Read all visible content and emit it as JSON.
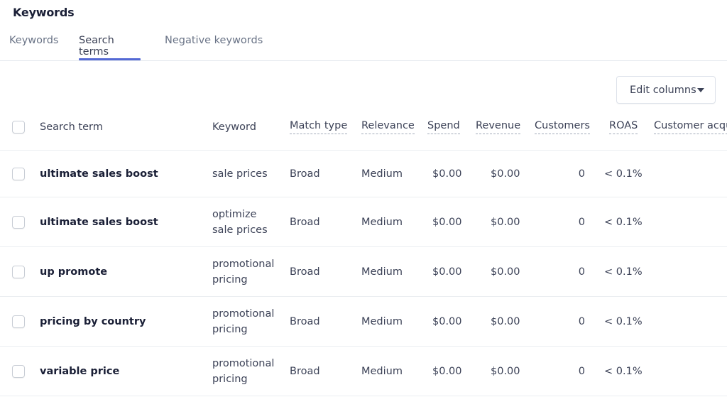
{
  "page": {
    "title": "Keywords"
  },
  "tabs": [
    {
      "label": "Keywords",
      "active": false
    },
    {
      "label": "Search terms",
      "active": true
    },
    {
      "label": "Negative keywords",
      "active": false
    }
  ],
  "toolbar": {
    "edit_columns_label": "Edit columns",
    "edit_columns_icon": "caret-down-icon"
  },
  "colors": {
    "accent": "#5469d4",
    "text_primary": "#1a1f36",
    "text_secondary": "#697386",
    "border": "#e3e8ee"
  },
  "table": {
    "columns": [
      {
        "key": "search_term",
        "label": "Search term"
      },
      {
        "key": "keyword",
        "label": "Keyword"
      },
      {
        "key": "match_type",
        "label": "Match type"
      },
      {
        "key": "relevance",
        "label": "Relevance"
      },
      {
        "key": "spend",
        "label": "Spend"
      },
      {
        "key": "revenue",
        "label": "Revenue"
      },
      {
        "key": "customers",
        "label": "Customers"
      },
      {
        "key": "roas",
        "label": "ROAS"
      },
      {
        "key": "customer_acquisition",
        "label": "Customer acqui"
      }
    ],
    "rows": [
      {
        "search_term": "ultimate sales boost",
        "keyword": "sale prices",
        "match_type": "Broad",
        "relevance": "Medium",
        "spend": "$0.00",
        "revenue": "$0.00",
        "customers": "0",
        "roas": "< 0.1%"
      },
      {
        "search_term": "ultimate sales boost",
        "keyword": "optimize sale prices",
        "match_type": "Broad",
        "relevance": "Medium",
        "spend": "$0.00",
        "revenue": "$0.00",
        "customers": "0",
        "roas": "< 0.1%"
      },
      {
        "search_term": "up promote",
        "keyword": "promotional pricing",
        "match_type": "Broad",
        "relevance": "Medium",
        "spend": "$0.00",
        "revenue": "$0.00",
        "customers": "0",
        "roas": "< 0.1%"
      },
      {
        "search_term": "pricing by country",
        "keyword": "promotional pricing",
        "match_type": "Broad",
        "relevance": "Medium",
        "spend": "$0.00",
        "revenue": "$0.00",
        "customers": "0",
        "roas": "< 0.1%"
      },
      {
        "search_term": "variable price",
        "keyword": "promotional pricing",
        "match_type": "Broad",
        "relevance": "Medium",
        "spend": "$0.00",
        "revenue": "$0.00",
        "customers": "0",
        "roas": "< 0.1%"
      }
    ]
  }
}
